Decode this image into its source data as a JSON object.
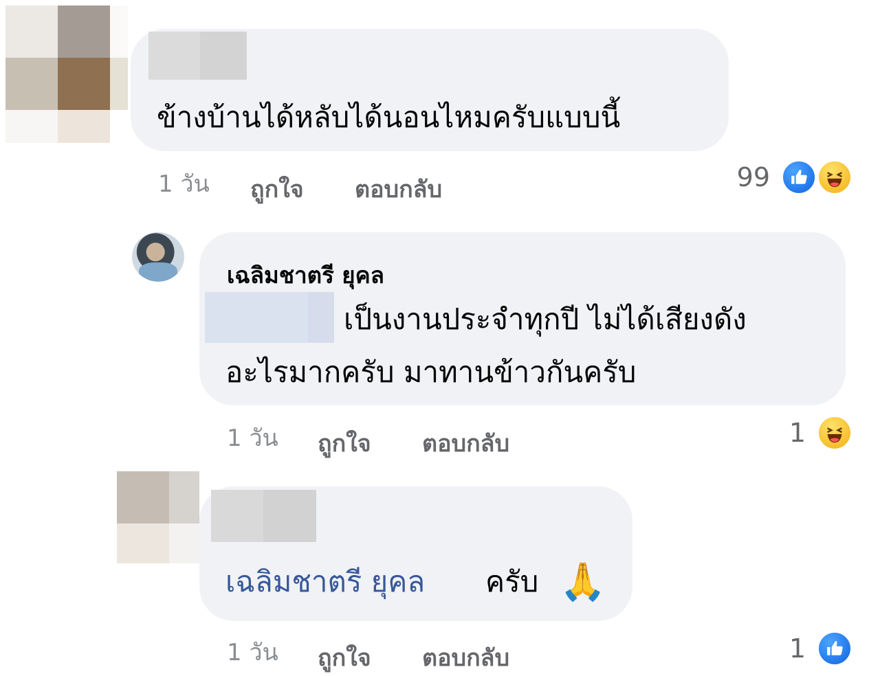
{
  "comments": [
    {
      "text": "ข้างบ้านได้หลับได้นอนไหมครับแบบนี้",
      "time": "1 วัน",
      "like_label": "ถูกใจ",
      "reply_label": "ตอบกลับ",
      "reaction_count": "99",
      "reactions": [
        "like-icon",
        "haha-icon"
      ]
    },
    {
      "author": "เฉลิมชาตรี ยุคล",
      "text_line1": "เป็นงานประจำทุกปี ไม่ได้เสียงดัง",
      "text_line2": "อะไรมากครับ มาทานข้าวกันครับ",
      "time": "1 วัน",
      "like_label": "ถูกใจ",
      "reply_label": "ตอบกลับ",
      "reaction_count": "1",
      "reactions": [
        "haha-icon"
      ]
    },
    {
      "mention": "เฉลิมชาตรี ยุคล",
      "text": "ครับ",
      "emoji": "🙏",
      "time": "1 วัน",
      "like_label": "ถูกใจ",
      "reply_label": "ตอบกลับ",
      "reaction_count": "1",
      "reactions": [
        "like-icon"
      ]
    }
  ],
  "colors": {
    "bubble": "#f0f2f5",
    "mention": "#385898",
    "meta": "#65676b",
    "like": "#1877f2",
    "haha": "#f7b125"
  }
}
